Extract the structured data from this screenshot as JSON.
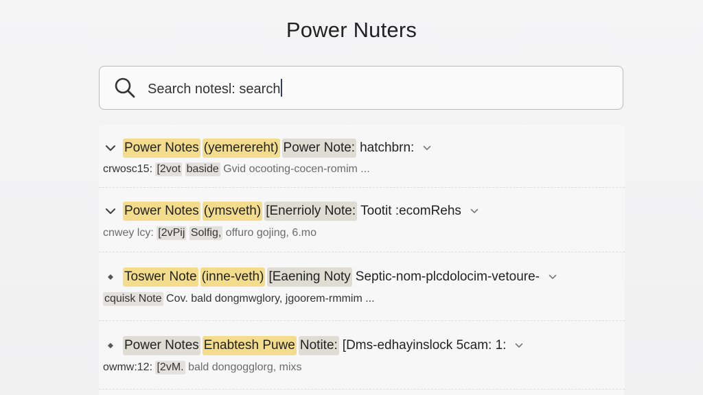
{
  "app": {
    "title": "Power Nuters"
  },
  "search": {
    "value": "Search notesl: search",
    "icon": "search-icon"
  },
  "results": [
    {
      "toggle_icon": "chevron-down-icon",
      "title_parts": [
        "Power Notes",
        "(yemerereht)",
        "Power Note:",
        "hatchbrn:"
      ],
      "meta_prefix": "crwosc15:",
      "meta_chips": [
        "[2vot",
        "baside"
      ],
      "meta_rest": "Gvid ocooting-cocen-romim ..."
    },
    {
      "toggle_icon": "chevron-down-icon",
      "title_parts": [
        "Power Notes",
        "(ymsveth)",
        "[Enerrioly Note:",
        "Tootit :ecomRehs"
      ],
      "meta_prefix": "cnwey lcy:",
      "meta_chips": [
        "[2vPij",
        "Solfig,"
      ],
      "meta_rest": "offuro gojing, 6.mo"
    },
    {
      "toggle_icon": "diamond-bullet-icon",
      "title_parts": [
        "Toswer Note",
        "(inne-veth)",
        "[Eaening Noty",
        "Septic-nom-plcdolocim-vetoure-"
      ],
      "meta_prefix": "cquisk Note",
      "meta_chips": [
        "Cov."
      ],
      "meta_rest": "bald dongmwglory, jgoorem-rmmim ..."
    },
    {
      "toggle_icon": "diamond-bullet-icon",
      "title_parts": [
        "Power Notes",
        "Enabtesh Puwe",
        "Notite:",
        "[Dms-edhayinslock 5cam: 1:"
      ],
      "meta_prefix": "owmw:12:",
      "meta_chips": [
        "[2vM."
      ],
      "meta_rest": "bald dongogglorg, mixs"
    }
  ]
}
